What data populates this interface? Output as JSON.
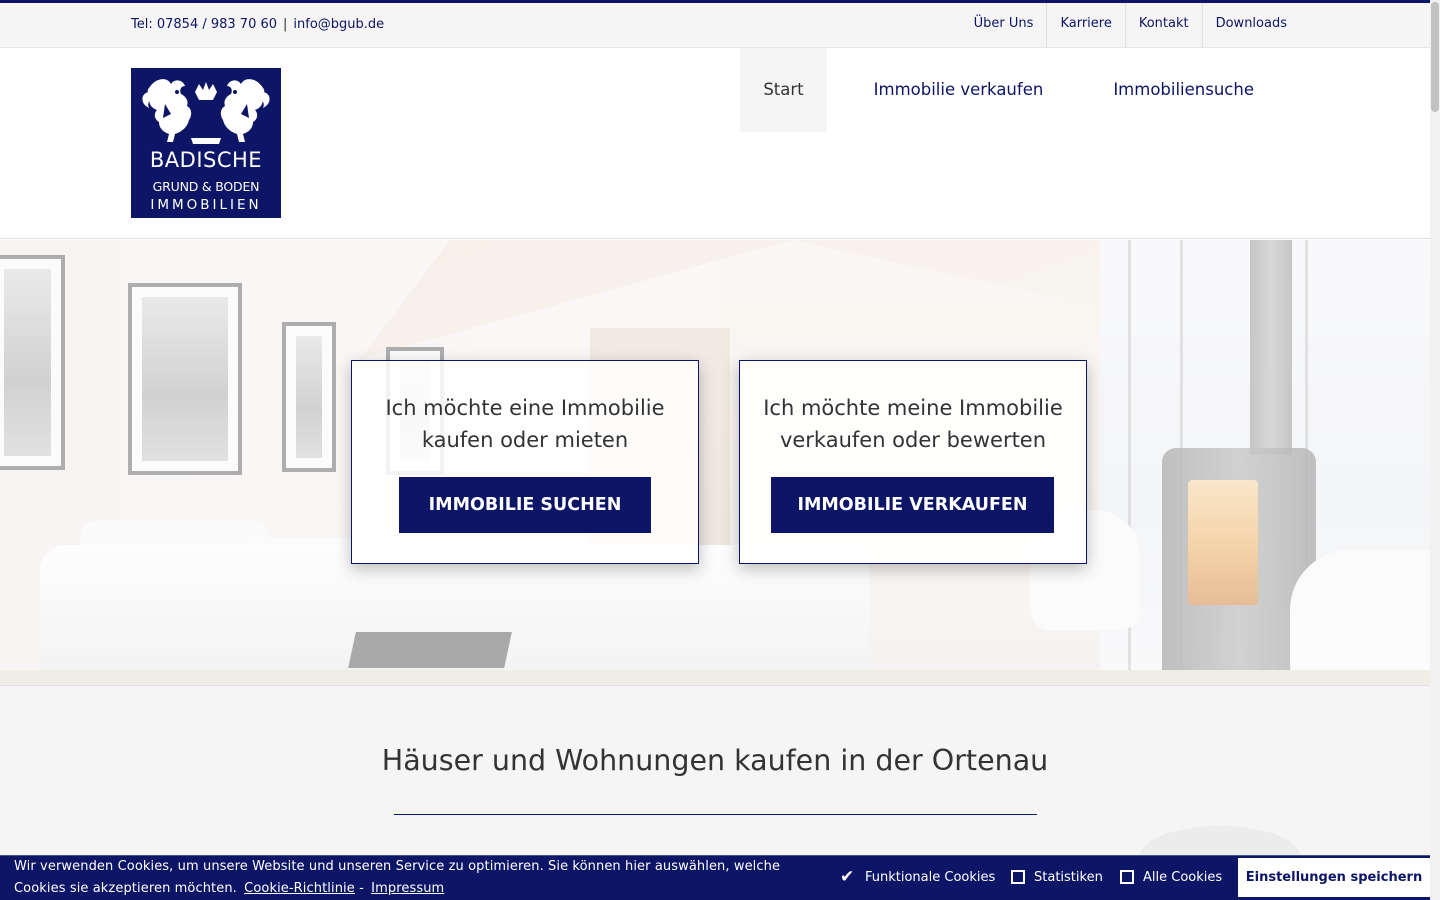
{
  "colors": {
    "brand": "#0d1566",
    "topbar_bg": "#f5f5f5",
    "text": "#333333"
  },
  "topbar": {
    "phone": "Tel: 07854 / 983 70 60",
    "separator": "|",
    "email": "info@bgub.de",
    "links": [
      "Über Uns",
      "Karriere",
      "Kontakt",
      "Downloads"
    ]
  },
  "logo": {
    "line1": "BADISCHE",
    "line2": "GRUND & BODEN",
    "line3": "IMMOBILIEN",
    "icon": "griffin-crest-icon"
  },
  "main_nav": {
    "items": [
      "Start",
      "Immobilie verkaufen",
      "Immobiliensuche"
    ],
    "active": "Start"
  },
  "hero": {
    "cta_left": {
      "line1": "Ich möchte eine Immobilie",
      "line2": "kaufen oder mieten",
      "button": "IMMOBILIE SUCHEN"
    },
    "cta_right": {
      "line1": "Ich möchte meine Immobilie",
      "line2": "verkaufen oder bewerten",
      "button": "IMMOBILIE VERKAUFEN"
    }
  },
  "content": {
    "title": "Häuser und Wohnungen kaufen in der Ortenau"
  },
  "cookie_bar": {
    "text": "Wir verwenden Cookies, um unsere Website und unseren Service zu optimieren. Sie können hier auswählen, welche Cookies sie akzeptieren möchten.",
    "policy_link": "Cookie-Richtlinie",
    "link_separator": "-",
    "imprint_link": "Impressum",
    "options": [
      {
        "label": "Funktionale Cookies",
        "checked": true
      },
      {
        "label": "Statistiken",
        "checked": false
      },
      {
        "label": "Alle Cookies",
        "checked": false
      }
    ],
    "save_label": "Einstellungen speichern"
  }
}
